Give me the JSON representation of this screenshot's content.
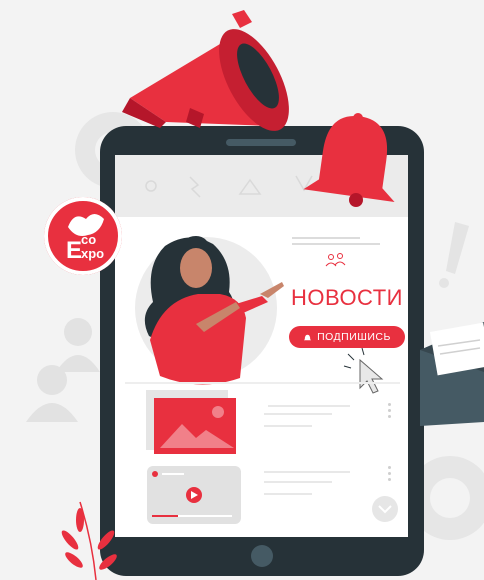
{
  "logo": {
    "e": "E",
    "co": "co",
    "xpo": "xpo"
  },
  "news": {
    "title": "НОВОСТИ"
  },
  "subscribe": {
    "label": "ПОДПИШИСЬ"
  },
  "colors": {
    "accent": "#e8303f",
    "dark": "#263238",
    "screen_bg": "#ebebeb"
  }
}
